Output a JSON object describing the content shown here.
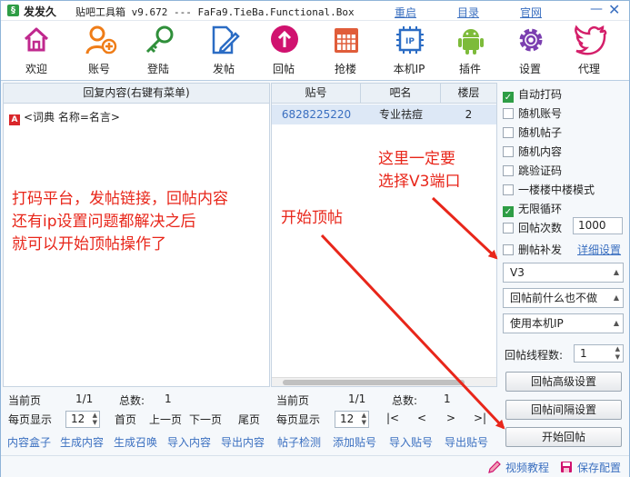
{
  "titlebar": {
    "logo_glyph": "§",
    "brand": "发发久",
    "title": "贴吧工具箱 v9.672 --- FaFa9.TieBa.Functional.Box",
    "links": [
      "重启",
      "目录",
      "官网"
    ],
    "min_glyph": "—",
    "close_glyph": "✕"
  },
  "toolbar": {
    "buttons": [
      {
        "label": "欢迎",
        "icon": "home-icon"
      },
      {
        "label": "账号",
        "icon": "add-user-icon"
      },
      {
        "label": "登陆",
        "icon": "key-icon"
      },
      {
        "label": "发帖",
        "icon": "edit-document-icon"
      },
      {
        "label": "回帖",
        "icon": "arrow-up-circle-icon"
      },
      {
        "label": "抢楼",
        "icon": "calendar-icon"
      },
      {
        "label": "本机IP",
        "icon": "ip-chip-icon"
      },
      {
        "label": "插件",
        "icon": "android-icon"
      },
      {
        "label": "设置",
        "icon": "gear-icon"
      },
      {
        "label": "代理",
        "icon": "twitter-bird-icon"
      }
    ]
  },
  "left_panel": {
    "header": "回复内容(右键有菜单)",
    "item": "<词典 名称=名言>",
    "item_icon": "A",
    "pager": {
      "current_label": "当前页",
      "current": "1/1",
      "total_label": "总数:",
      "total": "1",
      "per_page_label": "每页显示",
      "per_page": "12",
      "first": "首页",
      "prev": "上一页",
      "next": "下一页",
      "last": "尾页"
    },
    "bottom_links": [
      "内容盒子",
      "生成内容",
      "生成召唤",
      "导入内容",
      "导出内容"
    ]
  },
  "mid_panel": {
    "columns": [
      "贴号",
      "吧名",
      "楼层"
    ],
    "rows": [
      {
        "post_id": "6828225220",
        "bar": "专业祛痘",
        "floor": "2"
      }
    ],
    "pager": {
      "current_label": "当前页",
      "current": "1/1",
      "total_label": "总数:",
      "total": "1",
      "per_page_label": "每页显示",
      "per_page": "12",
      "first": "|<",
      "prev": "<",
      "next": ">",
      "last": ">|"
    },
    "bottom_links": [
      "帖子检测",
      "添加贴号",
      "导入贴号",
      "导出贴号"
    ]
  },
  "right_panel": {
    "options": [
      {
        "label": "自动打码",
        "checked": true
      },
      {
        "label": "随机账号",
        "checked": false
      },
      {
        "label": "随机帖子",
        "checked": false
      },
      {
        "label": "随机内容",
        "checked": false
      },
      {
        "label": "跳验证码",
        "checked": false
      },
      {
        "label": "一楼楼中楼模式",
        "checked": false
      },
      {
        "label": "无限循环",
        "checked": true
      },
      {
        "label": "回帖次数",
        "checked": false
      },
      {
        "label": "删帖补发",
        "checked": false
      }
    ],
    "retry_count": "1000",
    "detail_link": "详细设置",
    "port_select": "V3",
    "before_reply_select": "回帖前什么也不做",
    "ip_select": "使用本机IP",
    "threads_label": "回帖线程数:",
    "threads_value": "1",
    "buttons": [
      "回帖高级设置",
      "回帖间隔设置",
      "开始回帖"
    ],
    "check_glyph": "✓",
    "arrow_glyph": "▲"
  },
  "statusbar": {
    "video_link": "视频教程",
    "save_link": "保存配置"
  },
  "annotations": {
    "left_text": [
      "打码平台，发帖链接，回帖内容",
      "还有ip设置问题都解决之后",
      "就可以开始顶帖操作了"
    ],
    "start_text": "开始顶帖",
    "v3_text": [
      "这里一定要",
      "选择V3端口"
    ],
    "color": "#e8261a"
  },
  "colors": {
    "accent": "#3a6fc0",
    "check": "#2e9d45",
    "annotation": "#e8261a"
  }
}
